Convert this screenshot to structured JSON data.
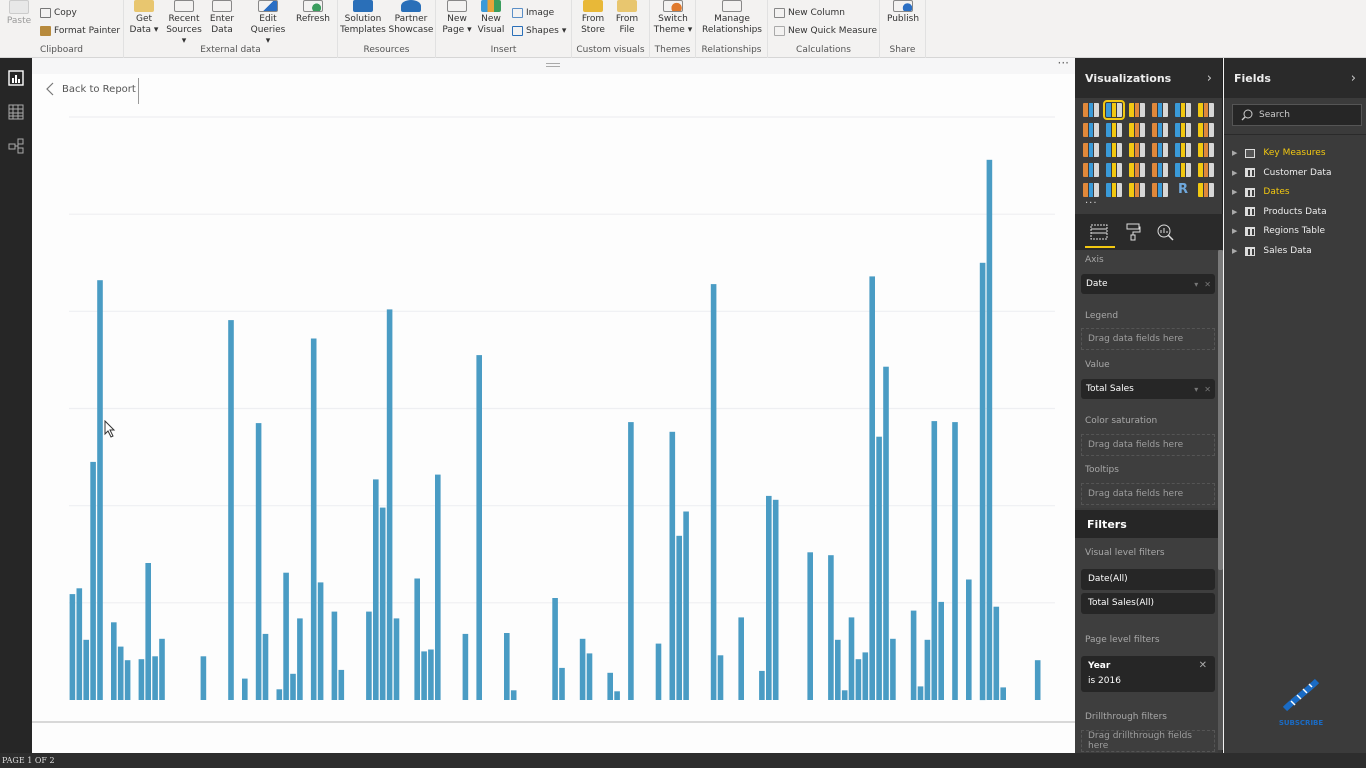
{
  "ribbon": {
    "groups": [
      {
        "label": "Clipboard",
        "buttons": [
          {
            "label": "Paste",
            "disabled": true
          },
          {
            "label": "Copy"
          },
          {
            "label": "Format Painter"
          }
        ]
      },
      {
        "label": "External data",
        "buttons": [
          {
            "label": "Get Data",
            "dropdown": true
          },
          {
            "label": "Recent Sources",
            "dropdown": true
          },
          {
            "label": "Enter Data"
          },
          {
            "label": "Edit Queries",
            "dropdown": true
          },
          {
            "label": "Refresh"
          }
        ]
      },
      {
        "label": "Resources",
        "buttons": [
          {
            "label": "Solution Templates"
          },
          {
            "label": "Partner Showcase"
          }
        ]
      },
      {
        "label": "Insert",
        "buttons": [
          {
            "label": "New Page",
            "dropdown": true
          },
          {
            "label": "New Visual"
          },
          {
            "label": "Image"
          },
          {
            "label": "Shapes",
            "dropdown": true
          }
        ]
      },
      {
        "label": "Custom visuals",
        "buttons": [
          {
            "label": "From Store"
          },
          {
            "label": "From File"
          }
        ]
      },
      {
        "label": "Themes",
        "buttons": [
          {
            "label": "Switch Theme",
            "dropdown": true
          }
        ]
      },
      {
        "label": "Relationships",
        "buttons": [
          {
            "label": "Manage Relationships"
          }
        ]
      },
      {
        "label": "Calculations",
        "buttons": [
          {
            "label": "New Column"
          },
          {
            "label": "New Quick Measure"
          }
        ]
      },
      {
        "label": "Share",
        "buttons": [
          {
            "label": "Publish"
          }
        ]
      }
    ]
  },
  "rail": {
    "items": [
      {
        "name": "report-view",
        "active": true
      },
      {
        "name": "data-view"
      },
      {
        "name": "relationships-view"
      }
    ]
  },
  "canvas": {
    "back_label": "Back to Report",
    "more_options": "···",
    "page_indicator": "PAGE 1 OF 2"
  },
  "visualizations": {
    "title": "Visualizations",
    "chevron": "›",
    "more": "···",
    "selected_index": 1,
    "icons": [
      "stacked-bar",
      "clustered-column",
      "clustered-bar",
      "stacked-column",
      "100-stacked-bar",
      "100-stacked-column",
      "line",
      "area",
      "stacked-area",
      "line-clustered-column",
      "line-stacked-column",
      "ribbon",
      "waterfall",
      "scatter",
      "pie",
      "donut",
      "treemap",
      "map",
      "filled-map",
      "shape-map",
      "funnel",
      "gauge",
      "multi-row-card",
      "card",
      "kpi",
      "slicer",
      "table",
      "matrix",
      "r-visual",
      "arcgis-map"
    ],
    "wells": {
      "axis": {
        "label": "Axis",
        "field": "Date"
      },
      "legend": {
        "label": "Legend",
        "placeholder": "Drag data fields here"
      },
      "value": {
        "label": "Value",
        "field": "Total Sales"
      },
      "color_saturation": {
        "label": "Color saturation",
        "placeholder": "Drag data fields here"
      },
      "tooltips": {
        "label": "Tooltips",
        "placeholder": "Drag data fields here"
      }
    }
  },
  "filters": {
    "title": "Filters",
    "visual_level": {
      "label": "Visual level filters",
      "items": [
        "Date(All)",
        "Total Sales(All)"
      ]
    },
    "page_level": {
      "label": "Page level filters",
      "items": [
        {
          "field": "Year",
          "condition": "is 2016"
        }
      ]
    },
    "drillthrough": {
      "label": "Drillthrough filters",
      "placeholder": "Drag drillthrough fields here"
    }
  },
  "fields": {
    "title": "Fields",
    "chevron": "›",
    "search_placeholder": "Search",
    "tables": [
      {
        "name": "Key Measures",
        "highlighted": true,
        "icon": "measure-table"
      },
      {
        "name": "Customer Data",
        "highlighted": false,
        "icon": "table"
      },
      {
        "name": "Dates",
        "highlighted": true,
        "icon": "table"
      },
      {
        "name": "Products Data",
        "highlighted": false,
        "icon": "table"
      },
      {
        "name": "Regions Table",
        "highlighted": false,
        "icon": "table"
      },
      {
        "name": "Sales Data",
        "highlighted": false,
        "icon": "table"
      }
    ]
  },
  "overlay": {
    "subscribe_label": "SUBSCRIBE"
  },
  "colors": {
    "bar": "#4a9cc4",
    "accent": "#f2c811",
    "pane_bg": "#3b3b3b"
  },
  "chart_data": {
    "type": "bar",
    "title": "",
    "xlabel": "",
    "ylabel": "",
    "units_note": "Values in gridline units (no axis labels visible); 1 unit = one gridline interval",
    "grid": true,
    "ylim": [
      0,
      6
    ],
    "gridlines": [
      1,
      2,
      3,
      4,
      5,
      6
    ],
    "x_axis": "Date (daily, 2016)",
    "slots": 143,
    "bars": [
      [
        0,
        1.09
      ],
      [
        1,
        1.15
      ],
      [
        2,
        0.62
      ],
      [
        3,
        2.45
      ],
      [
        4,
        4.32
      ],
      [
        6,
        0.8
      ],
      [
        7,
        0.55
      ],
      [
        8,
        0.41
      ],
      [
        10,
        0.42
      ],
      [
        11,
        1.41
      ],
      [
        12,
        0.45
      ],
      [
        13,
        0.63
      ],
      [
        19,
        0.45
      ],
      [
        23,
        3.91
      ],
      [
        25,
        0.22
      ],
      [
        27,
        2.85
      ],
      [
        28,
        0.68
      ],
      [
        30,
        0.11
      ],
      [
        31,
        1.31
      ],
      [
        32,
        0.27
      ],
      [
        33,
        0.84
      ],
      [
        35,
        3.72
      ],
      [
        36,
        1.21
      ],
      [
        38,
        0.91
      ],
      [
        39,
        0.31
      ],
      [
        43,
        0.91
      ],
      [
        44,
        2.27
      ],
      [
        45,
        1.98
      ],
      [
        46,
        4.02
      ],
      [
        47,
        0.84
      ],
      [
        50,
        1.25
      ],
      [
        51,
        0.5
      ],
      [
        52,
        0.52
      ],
      [
        53,
        2.32
      ],
      [
        57,
        0.68
      ],
      [
        59,
        3.55
      ],
      [
        63,
        0.69
      ],
      [
        64,
        0.1
      ],
      [
        70,
        1.05
      ],
      [
        71,
        0.33
      ],
      [
        74,
        0.63
      ],
      [
        75,
        0.48
      ],
      [
        78,
        0.28
      ],
      [
        79,
        0.09
      ],
      [
        81,
        2.86
      ],
      [
        85,
        0.58
      ],
      [
        87,
        2.76
      ],
      [
        88,
        1.69
      ],
      [
        89,
        1.94
      ],
      [
        93,
        4.28
      ],
      [
        94,
        0.46
      ],
      [
        97,
        0.85
      ],
      [
        100,
        0.3
      ],
      [
        101,
        2.1
      ],
      [
        102,
        2.06
      ],
      [
        107,
        1.52
      ],
      [
        110,
        1.49
      ],
      [
        111,
        0.62
      ],
      [
        112,
        0.1
      ],
      [
        113,
        0.85
      ],
      [
        114,
        0.42
      ],
      [
        115,
        0.49
      ],
      [
        116,
        4.36
      ],
      [
        117,
        2.71
      ],
      [
        118,
        3.43
      ],
      [
        119,
        0.63
      ],
      [
        122,
        0.92
      ],
      [
        123,
        0.14
      ],
      [
        124,
        0.62
      ],
      [
        125,
        2.87
      ],
      [
        126,
        1.01
      ],
      [
        128,
        2.86
      ],
      [
        130,
        1.24
      ],
      [
        132,
        4.5
      ],
      [
        133,
        5.56
      ],
      [
        134,
        0.96
      ],
      [
        135,
        0.13
      ],
      [
        140,
        0.41
      ]
    ]
  }
}
